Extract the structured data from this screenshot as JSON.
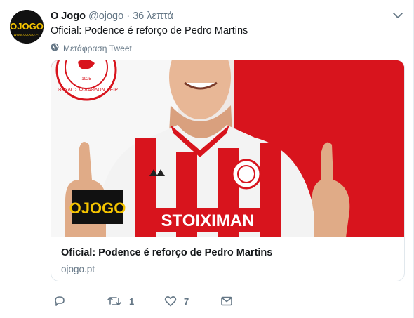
{
  "tweet": {
    "display_name": "O Jogo",
    "handle": "@ojogo",
    "separator": "·",
    "time": "36 λεπτά",
    "text": "Oficial: Podence é reforço de Pedro Martins",
    "translate_label": "Μετάφραση Tweet"
  },
  "avatar": {
    "logo_text": "OJOGO",
    "logo_subtext": "WWW.OJOGO.PT"
  },
  "card": {
    "title": "Oficial: Podence é reforço de Pedro Martins",
    "domain": "ojogo.pt",
    "image_logo_text": "OJOGO",
    "shirt_text": "STOIXIMAN",
    "crest_text": "ΘΡΥΛΟΣ ΦΙΛΑΘΛΩΝ ΠΕΙΡ",
    "crest_year": "1925"
  },
  "actions": {
    "reply_count": "",
    "retweet_count": "1",
    "like_count": "7"
  },
  "colors": {
    "text": "#14171a",
    "secondary": "#657786",
    "border": "#e1e8ed",
    "jersey_red": "#d8141d",
    "logo_yellow": "#f5c400"
  },
  "icons": [
    "caret-down-icon",
    "globe-icon",
    "reply-icon",
    "retweet-icon",
    "heart-icon",
    "message-icon"
  ]
}
